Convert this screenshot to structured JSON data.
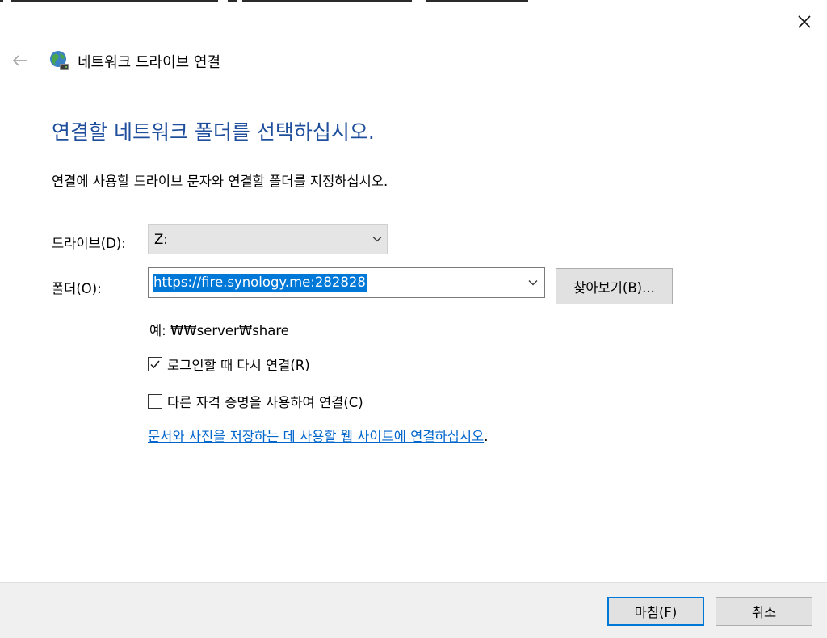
{
  "window": {
    "title": "네트워크 드라이브 연결",
    "back_icon": "back-arrow-icon",
    "close_icon": "close-icon",
    "app_icon": "network-drive-icon"
  },
  "main": {
    "heading": "연결할 네트워크 폴더를 선택하십시오.",
    "description": "연결에 사용할 드라이브 문자와 연결할 폴더를 지정하십시오.",
    "drive_label": "드라이브(D):",
    "drive_value": "Z:",
    "folder_label": "폴더(O):",
    "folder_value": "https://fire.synology.me:282828",
    "browse_label": "찾아보기(B)...",
    "example_text": "예: ₩₩server₩share",
    "reconnect_label": "로그인할 때 다시 연결(R)",
    "reconnect_checked": true,
    "credentials_label": "다른 자격 증명을 사용하여 연결(C)",
    "credentials_checked": false,
    "link_text": "문서와 사진을 저장하는 데 사용할 웹 사이트에 연결하십시오",
    "link_suffix": "."
  },
  "footer": {
    "finish_label": "마침(F)",
    "cancel_label": "취소"
  },
  "colors": {
    "heading": "#1f4e9c",
    "link": "#0066cc",
    "selection": "#0078d7",
    "footer_bg": "#f0f0f0"
  }
}
